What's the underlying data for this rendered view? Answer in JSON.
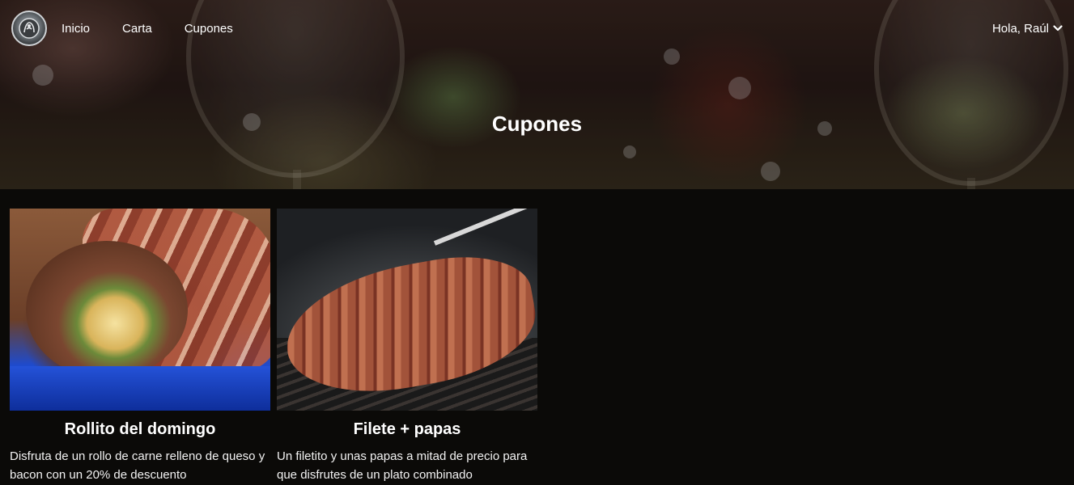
{
  "nav": {
    "logo_alt": "logo",
    "links": [
      {
        "label": "Inicio"
      },
      {
        "label": "Carta"
      },
      {
        "label": "Cupones"
      }
    ],
    "user_greeting": "Hola, Raúl"
  },
  "hero": {
    "title": "Cupones"
  },
  "coupons": [
    {
      "title": "Rollito del domingo",
      "description": "Disfruta de un rollo de carne relleno de queso y bacon con un 20% de descuento",
      "image": "bacon-wrapped meat roll"
    },
    {
      "title": "Filete + papas",
      "description": "Un filetito y unas papas a mitad de precio para que disfrutes de un plato combinado",
      "image": "steak on grill"
    }
  ],
  "colors": {
    "page_background": "#0b0a08",
    "text": "#ffffff"
  }
}
